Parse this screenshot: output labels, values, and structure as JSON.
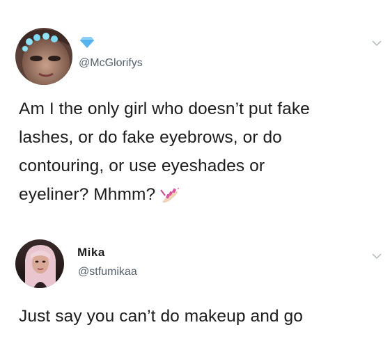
{
  "tweets": [
    {
      "handle": "@McGlorifys",
      "badge_icon": "blue-diamond-icon",
      "text_lines": [
        "Am I the only girl who doesn’t put fake",
        "lashes, or do fake eyebrows, or do",
        "contouring, or use eyeshades or",
        "eyeliner? Mhmm?"
      ],
      "trailing_emoji": "nail-polish-emoji"
    },
    {
      "display_name": "Mika",
      "handle": "@stfumikaa",
      "text_lines": [
        "Just say you can’t do makeup and go"
      ]
    }
  ],
  "colors": {
    "text": "#1c1c1c",
    "handle": "#56606b",
    "chevron": "#b8bec6",
    "diamond": "#56b4f0"
  }
}
